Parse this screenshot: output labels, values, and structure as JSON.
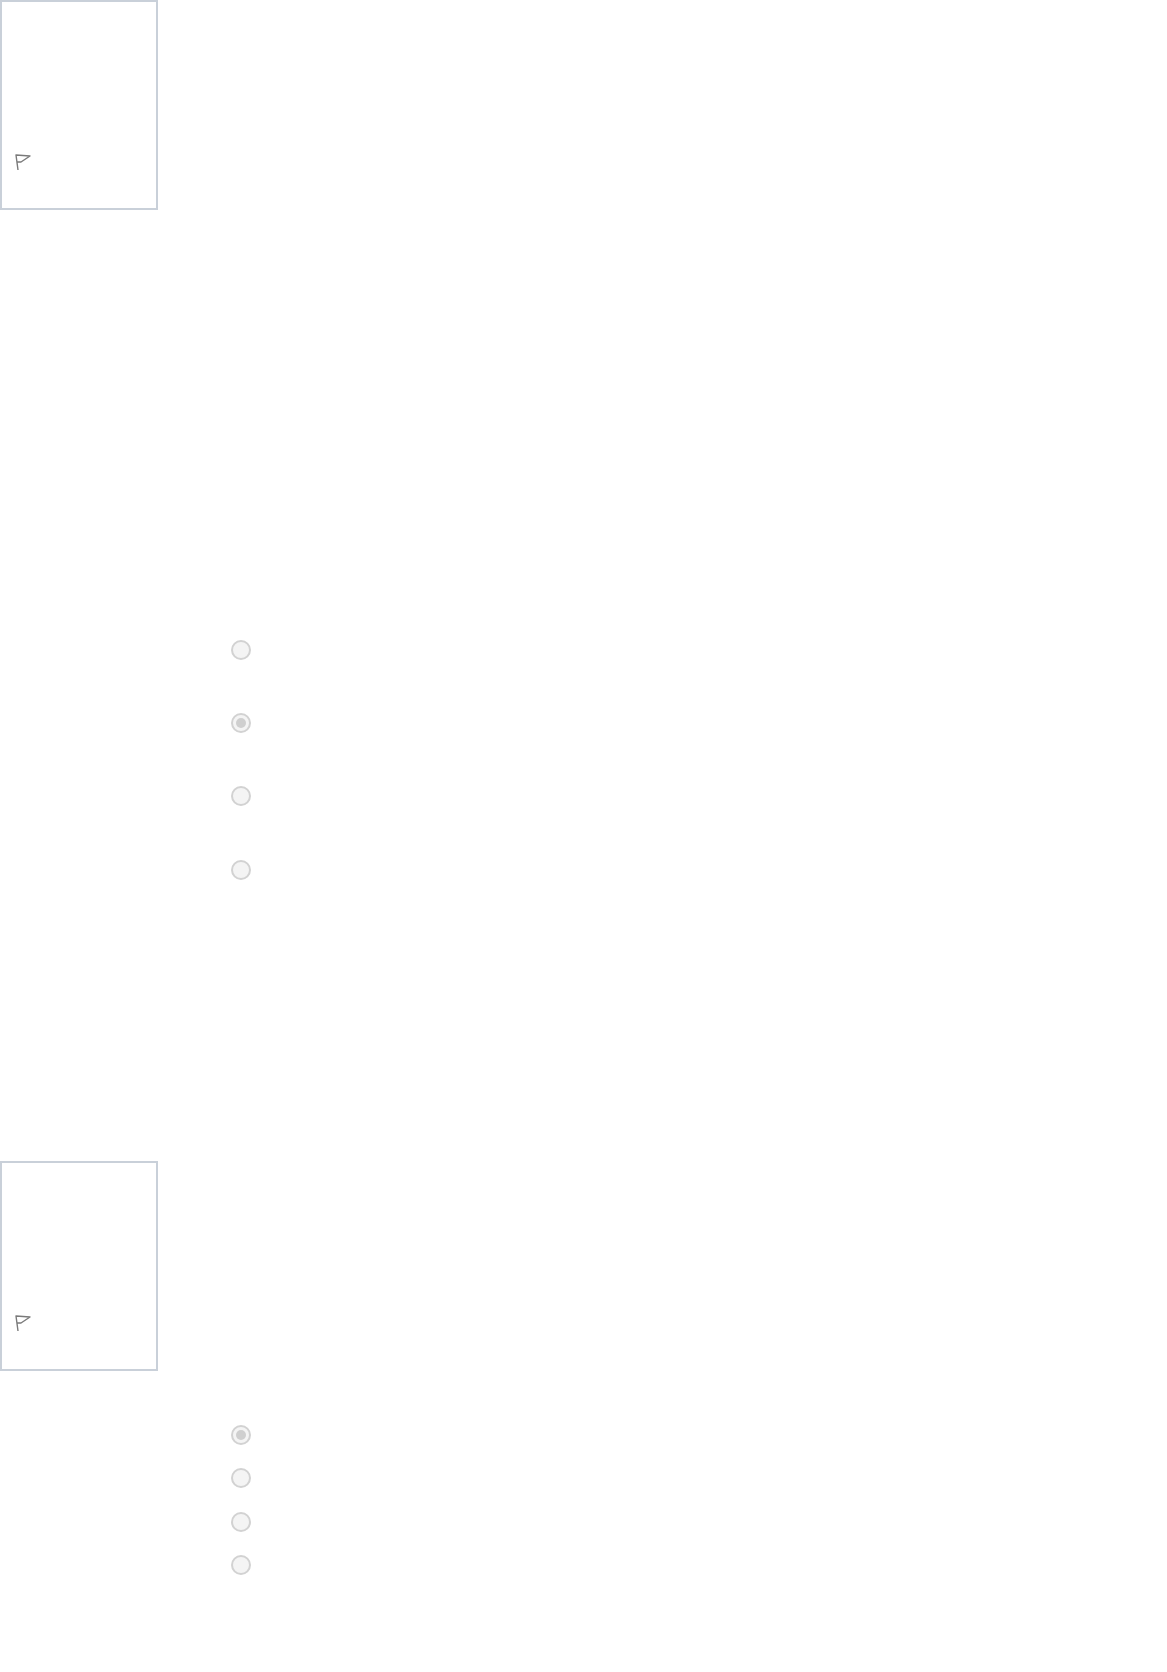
{
  "questions": [
    {
      "kind": "tall",
      "options": [
        {
          "selected": false
        },
        {
          "selected": true
        },
        {
          "selected": false
        },
        {
          "selected": false
        }
      ]
    },
    {
      "kind": "compact",
      "options": [
        {
          "selected": true
        },
        {
          "selected": false
        },
        {
          "selected": false
        },
        {
          "selected": false
        }
      ]
    }
  ]
}
